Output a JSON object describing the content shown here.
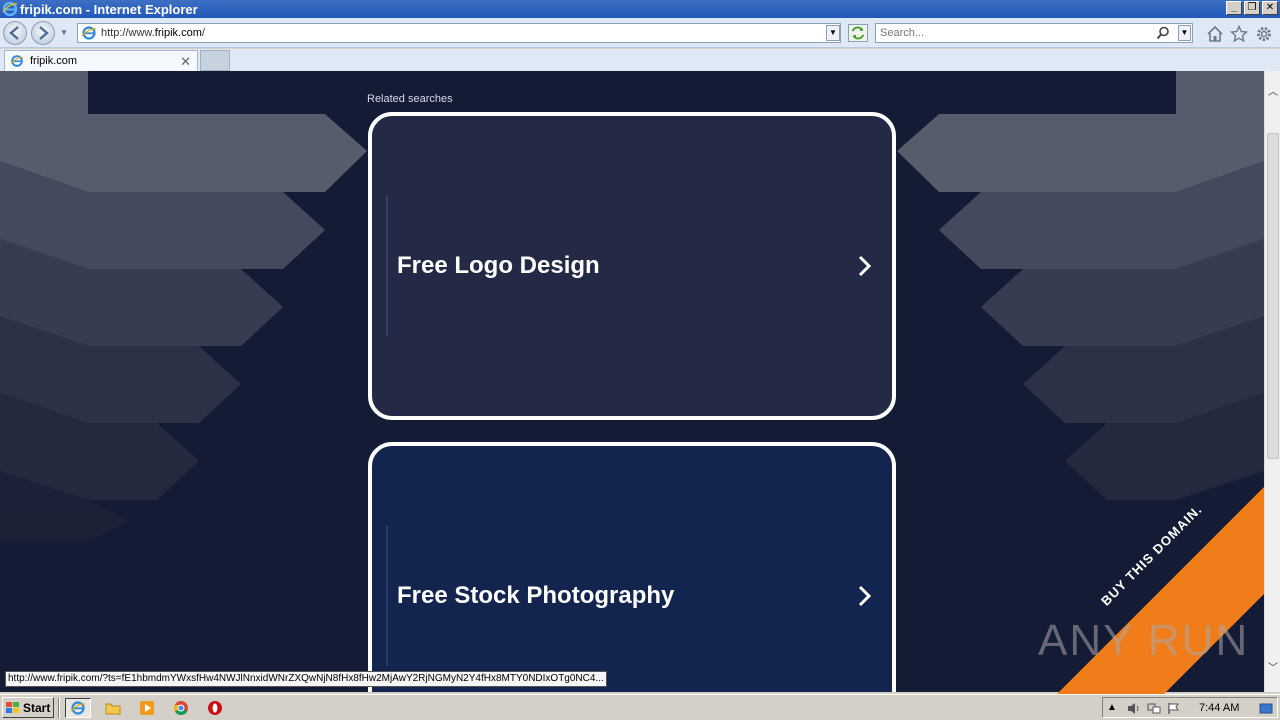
{
  "window": {
    "title": "fripik.com - Internet Explorer",
    "controls": [
      "_",
      "❐",
      "✕"
    ]
  },
  "address_bar": {
    "url_prefix": "http://www.",
    "url_domain": "fripik.com",
    "url_suffix": "/"
  },
  "search": {
    "placeholder": "Search..."
  },
  "tabs": [
    {
      "label": "fripik.com"
    }
  ],
  "page": {
    "related_heading": "Related searches",
    "cards": [
      {
        "label": "Free Logo Design"
      },
      {
        "label": "Free Stock Photography"
      }
    ]
  },
  "status_url": "http://www.fripik.com/?ts=fE1hbmdmYWxsfHw4NWJlNnxidWNrZXQwNjN8fHx8fHw2MjAwY2RjNGMyN2Y4fHx8MTY0NDIxOTg0NC4...",
  "watermark": {
    "text": "ANY RUN",
    "banner": "BUY THIS DOMAIN."
  },
  "taskbar": {
    "start_label": "Start",
    "clock": "7:44 AM"
  },
  "colors": {
    "page_bg": "#141c35",
    "card1_bg": "#242a45",
    "card2_bg": "#13244e",
    "banner": "#f07c1a"
  }
}
